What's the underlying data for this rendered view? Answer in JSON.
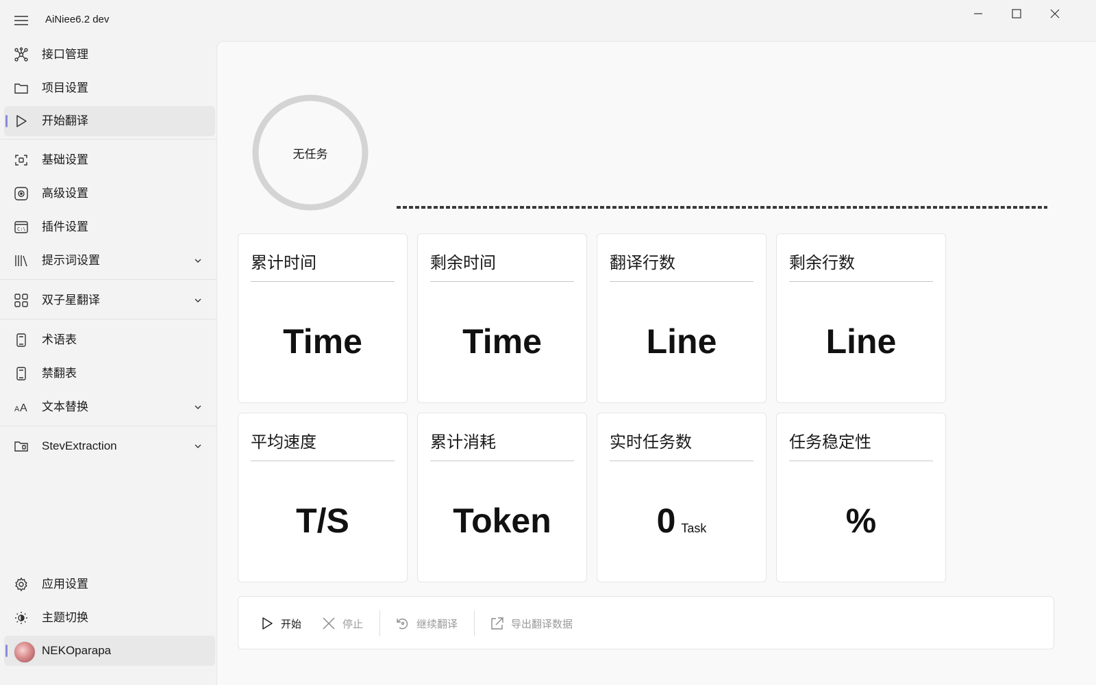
{
  "window": {
    "title": "AiNiee6.2 dev"
  },
  "sidebar": {
    "items": [
      {
        "label": "接口管理",
        "icon": "api-hub-icon"
      },
      {
        "label": "项目设置",
        "icon": "folder-icon"
      },
      {
        "label": "开始翻译",
        "icon": "play-icon",
        "active": true
      },
      {
        "label": "基础设置",
        "icon": "basic-settings-icon"
      },
      {
        "label": "高级设置",
        "icon": "advanced-settings-icon"
      },
      {
        "label": "插件设置",
        "icon": "plugin-icon"
      },
      {
        "label": "提示词设置",
        "icon": "library-icon",
        "expandable": true
      },
      {
        "label": "双子星翻译",
        "icon": "grid-icon",
        "expandable": true
      },
      {
        "label": "术语表",
        "icon": "book-icon"
      },
      {
        "label": "禁翻表",
        "icon": "book-icon"
      },
      {
        "label": "文本替换",
        "icon": "text-size-icon",
        "expandable": true
      },
      {
        "label": "StevExtraction",
        "icon": "folder-extract-icon",
        "expandable": true
      }
    ],
    "footer": [
      {
        "label": "应用设置",
        "icon": "gear-icon"
      },
      {
        "label": "主题切换",
        "icon": "brightness-icon"
      },
      {
        "label": "NEKOparapa",
        "icon": "avatar"
      }
    ]
  },
  "progress": {
    "status": "无任务"
  },
  "stats": [
    {
      "title": "累计时间",
      "value": "Time",
      "unit": ""
    },
    {
      "title": "剩余时间",
      "value": "Time",
      "unit": ""
    },
    {
      "title": "翻译行数",
      "value": "Line",
      "unit": ""
    },
    {
      "title": "剩余行数",
      "value": "Line",
      "unit": ""
    },
    {
      "title": "平均速度",
      "value": "T/S",
      "unit": ""
    },
    {
      "title": "累计消耗",
      "value": "Token",
      "unit": ""
    },
    {
      "title": "实时任务数",
      "value": "0",
      "unit": "Task"
    },
    {
      "title": "任务稳定性",
      "value": "%",
      "unit": ""
    }
  ],
  "commands": {
    "start": "开始",
    "stop": "停止",
    "continue": "继续翻译",
    "export": "导出翻译数据"
  },
  "colors": {
    "accent": "#8a8ad8",
    "ring": "#d4d4d4",
    "background": "#f3f3f3"
  }
}
